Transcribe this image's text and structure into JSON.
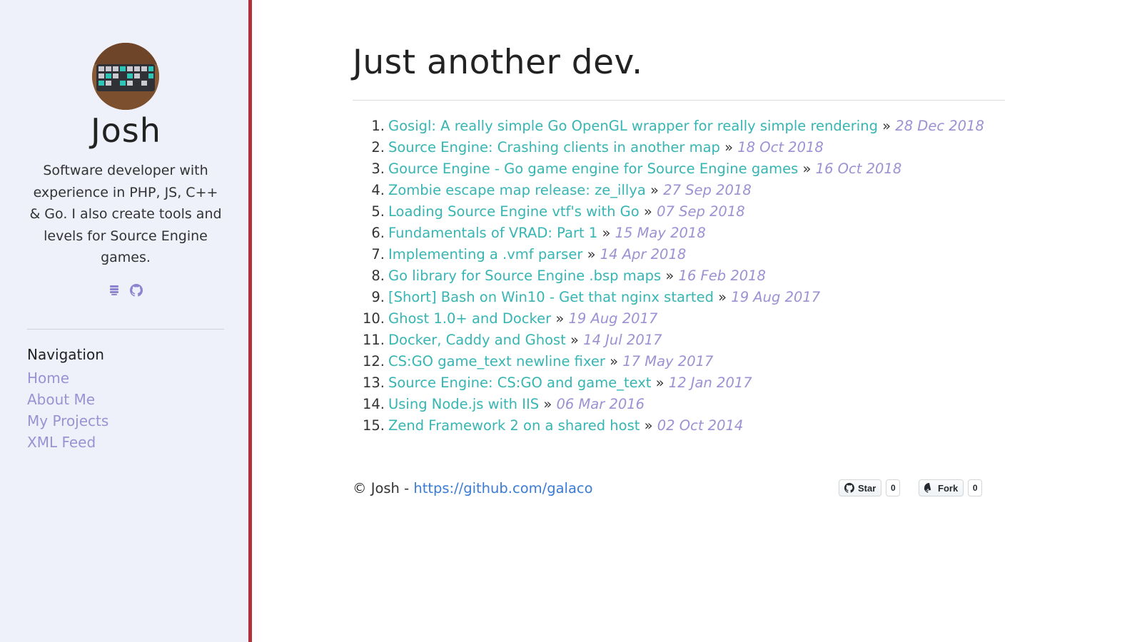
{
  "author": {
    "name": "Josh",
    "bio": "Software developer with experience in PHP, JS, C++ & Go. I also create tools and levels for Source Engine games."
  },
  "social": [
    {
      "icon": "stack-icon"
    },
    {
      "icon": "github-icon"
    }
  ],
  "navigation": {
    "title": "Navigation",
    "items": [
      {
        "label": "Home"
      },
      {
        "label": "About Me"
      },
      {
        "label": "My Projects"
      },
      {
        "label": "XML Feed"
      }
    ]
  },
  "page_title": "Just another dev.",
  "posts": [
    {
      "num": "1.",
      "title": "Gosigl: A really simple Go OpenGL wrapper for really simple rendering",
      "date": "28 Dec 2018"
    },
    {
      "num": "2.",
      "title": "Source Engine: Crashing clients in another map",
      "date": "18 Oct 2018"
    },
    {
      "num": "3.",
      "title": "Gource Engine - Go game engine for Source Engine games",
      "date": "16 Oct 2018"
    },
    {
      "num": "4.",
      "title": "Zombie escape map release: ze_illya",
      "date": "27 Sep 2018"
    },
    {
      "num": "5.",
      "title": "Loading Source Engine vtf's with Go",
      "date": "07 Sep 2018"
    },
    {
      "num": "6.",
      "title": "Fundamentals of VRAD: Part 1",
      "date": "15 May 2018"
    },
    {
      "num": "7.",
      "title": "Implementing a .vmf parser",
      "date": "14 Apr 2018"
    },
    {
      "num": "8.",
      "title": "Go library for Source Engine .bsp maps",
      "date": "16 Feb 2018"
    },
    {
      "num": "9.",
      "title": "[Short] Bash on Win10 - Get that nginx started",
      "date": "19 Aug 2017"
    },
    {
      "num": "10.",
      "title": "Ghost 1.0+ and Docker",
      "date": "19 Aug 2017"
    },
    {
      "num": "11.",
      "title": "Docker, Caddy and Ghost",
      "date": "14 Jul 2017"
    },
    {
      "num": "12.",
      "title": "CS:GO game_text newline fixer",
      "date": "17 May 2017"
    },
    {
      "num": "13.",
      "title": "Source Engine: CS:GO and game_text",
      "date": "12 Jan 2017"
    },
    {
      "num": "14.",
      "title": "Using Node.js with IIS",
      "date": "06 Mar 2016"
    },
    {
      "num": "15.",
      "title": "Zend Framework 2 on a shared host",
      "date": "02 Oct 2014"
    }
  ],
  "separator": "»",
  "footer": {
    "prefix": "© Josh - ",
    "link": "https://github.com/galaco"
  },
  "github_buttons": {
    "star_label": "Star",
    "star_count": "0",
    "fork_label": "Fork",
    "fork_count": "0"
  },
  "colors": {
    "sidebar_bg": "#eef0fa",
    "sidebar_border": "#b3323a",
    "link_teal": "#36b5b3",
    "date_purple": "#9a92d2",
    "footer_link": "#3a7bd5"
  }
}
